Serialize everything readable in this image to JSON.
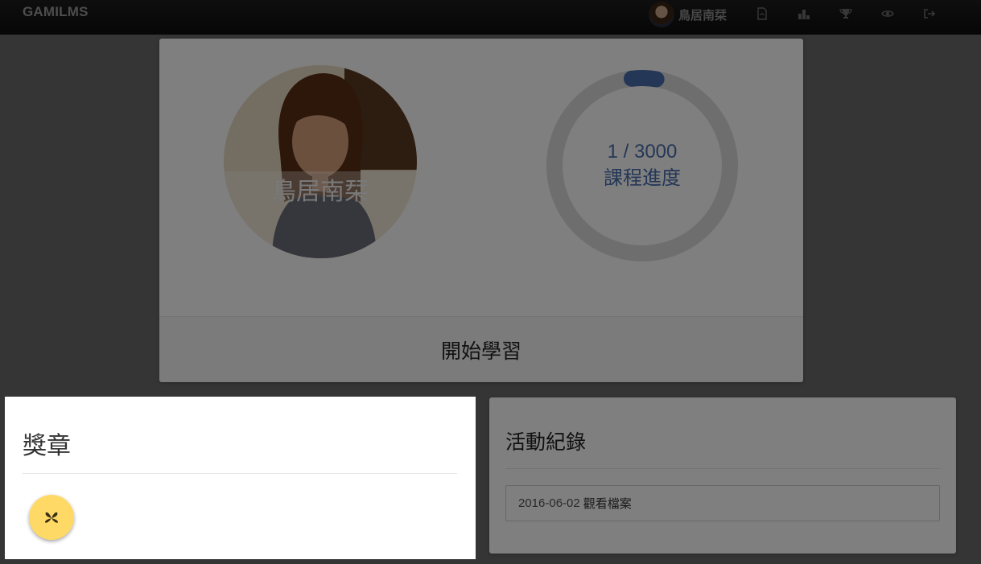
{
  "navbar": {
    "brand": "GAMILMS",
    "username": "鳥居南栞",
    "icons": [
      "document-icon",
      "podium-icon",
      "trophy-icon",
      "eye-icon",
      "sign-out-icon"
    ]
  },
  "profile": {
    "name": "鳥居南栞",
    "progress_text": "1 / 3000",
    "progress_label": "課程進度",
    "progress_fraction": 0.000333,
    "progress_color": "#4b6fae",
    "start_button_label": "開始學習"
  },
  "badges": {
    "title": "獎章",
    "items": [
      {
        "icon": "leaf-icon",
        "color": "#ffd966"
      }
    ]
  },
  "activity": {
    "title": "活動紀錄",
    "items": [
      {
        "date": "2016-06-02",
        "text": "觀看檔案"
      }
    ]
  }
}
